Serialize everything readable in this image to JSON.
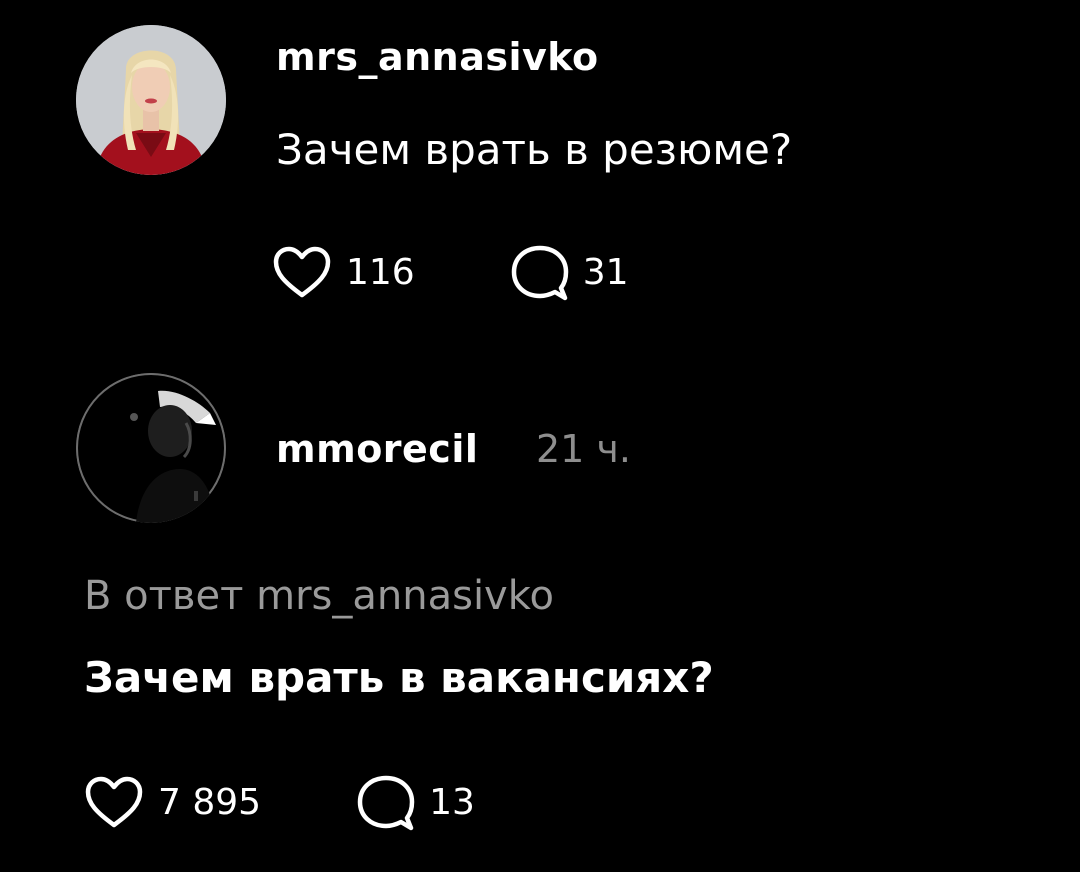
{
  "posts": [
    {
      "username": "mrs_annasivko",
      "text": "Зачем врать в резюме?",
      "likes": "116",
      "comments": "31",
      "avatar_icon": "profile-photo-woman-red-blouse"
    },
    {
      "username": "mmorecil",
      "time": "21 ч.",
      "reply_prefix": "В ответ mrs_annasivko",
      "text": "Зачем врать в вакансиях?",
      "likes": "7 895",
      "comments": "13",
      "avatar_icon": "profile-photo-man-dark"
    }
  ],
  "icons": {
    "like": "heart-icon",
    "comment": "speech-bubble-icon"
  },
  "colors": {
    "background": "#000000",
    "primary_text": "#ffffff",
    "secondary_text": "#8e8e8e"
  }
}
